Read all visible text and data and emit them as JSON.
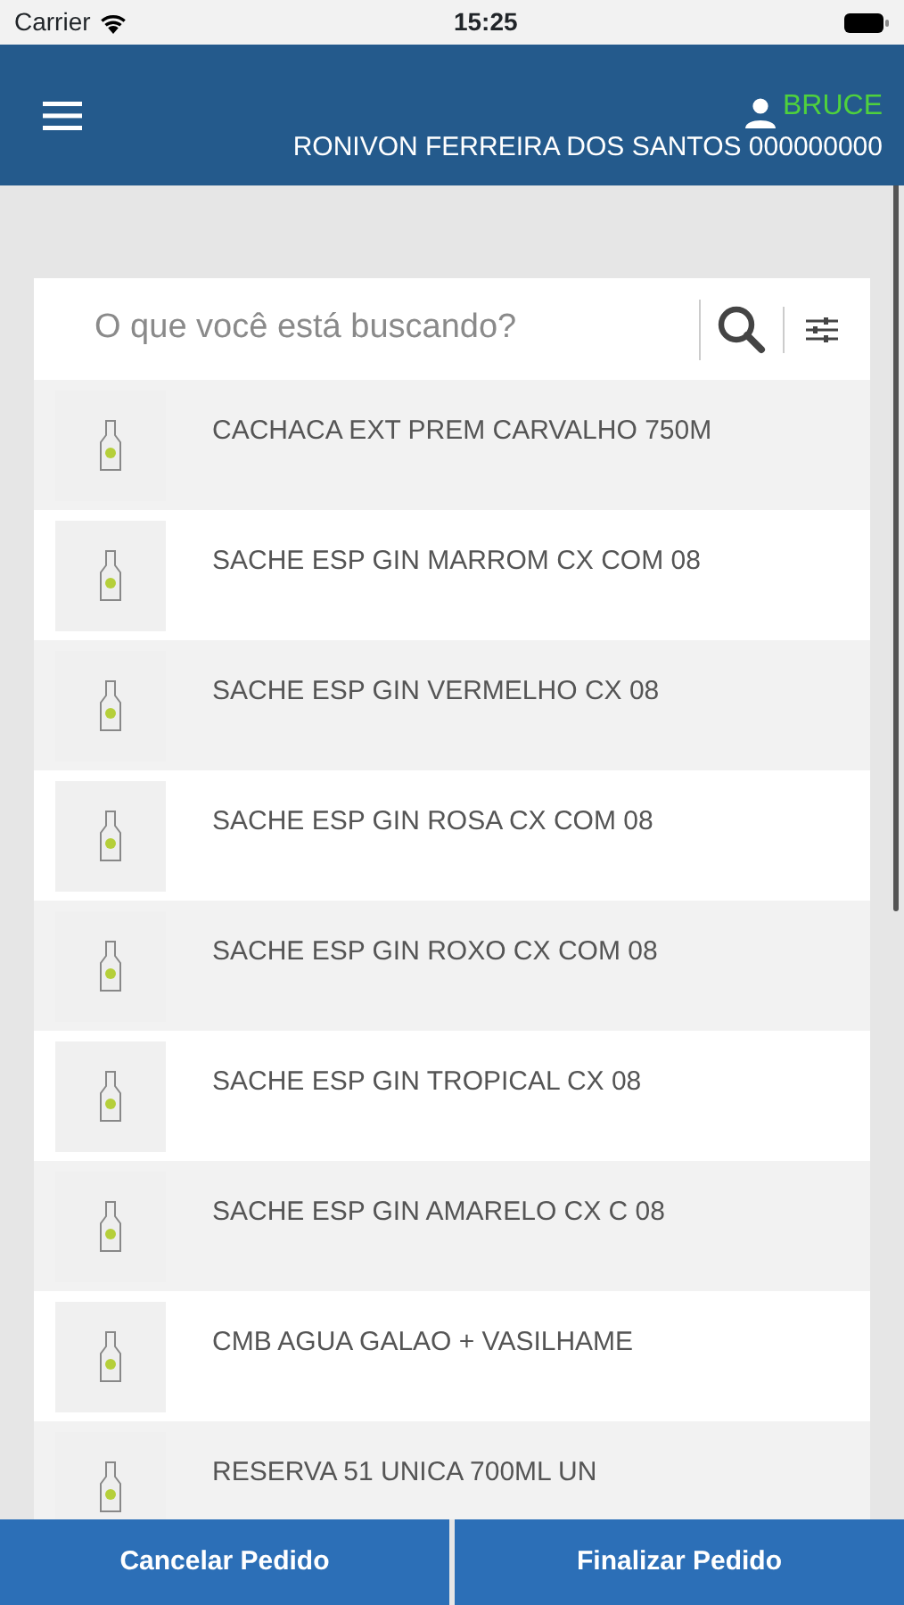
{
  "status_bar": {
    "carrier": "Carrier",
    "time": "15:25"
  },
  "header": {
    "user": "BRUCE",
    "customer": "RONIVON FERREIRA DOS SANTOS 000000000"
  },
  "search": {
    "placeholder": "O que você está buscando?"
  },
  "products": [
    {
      "name": "CACHACA EXT PREM CARVALHO 750M"
    },
    {
      "name": "SACHE ESP GIN MARROM CX COM 08"
    },
    {
      "name": "SACHE ESP GIN VERMELHO CX 08"
    },
    {
      "name": "SACHE ESP GIN ROSA CX COM 08"
    },
    {
      "name": "SACHE ESP GIN ROXO CX COM 08"
    },
    {
      "name": "SACHE ESP GIN TROPICAL CX 08"
    },
    {
      "name": "SACHE ESP GIN AMARELO CX C 08"
    },
    {
      "name": "CMB AGUA GALAO + VASILHAME"
    },
    {
      "name": "RESERVA 51 UNICA 700ML UN"
    }
  ],
  "buttons": [
    "Cancelar Pedido",
    "Finalizar Pedido"
  ]
}
